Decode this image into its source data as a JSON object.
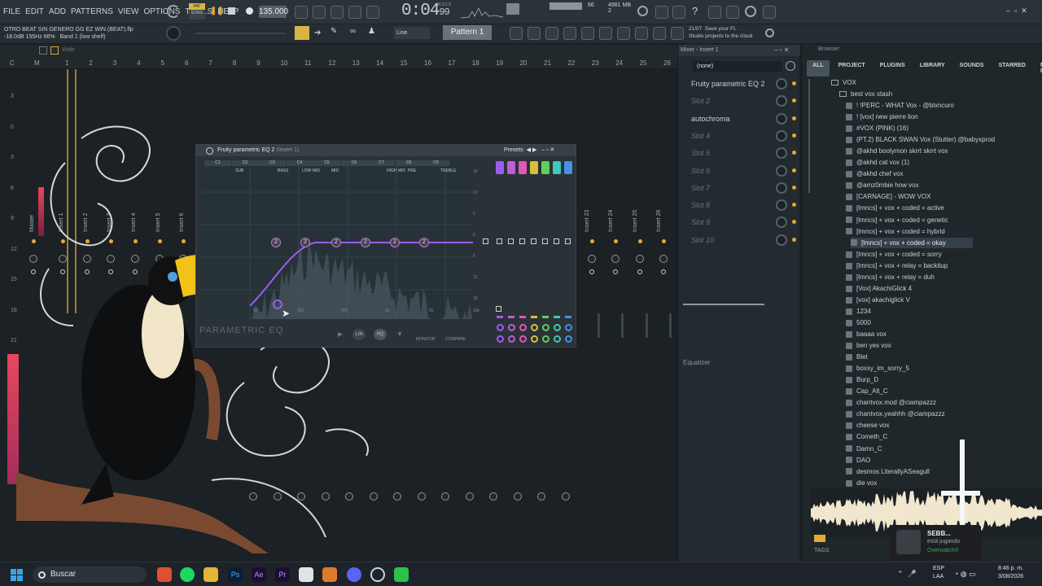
{
  "menu": [
    "FILE",
    "EDIT",
    "ADD",
    "PATTERNS",
    "VIEW",
    "OPTIONS",
    "TOOLS",
    "HELP"
  ],
  "transport": {
    "pat_label": "PAT",
    "song_label": "SONG",
    "tempo": "135.000",
    "time_main": "0:04",
    "time_sub": "99",
    "time_unit": "M:S:CS",
    "cpu_value": "66",
    "memory": "4981 MB",
    "memory_sub": "2"
  },
  "hint": {
    "line1": "OTRO BEAT SIN GENERO GG EZ WIN (BEAT).flp",
    "line2": "-18.0dB 155Hz 66%",
    "line3": "Band 1 (low shelf)"
  },
  "toolbar": {
    "snap": "Line",
    "pattern": "Pattern 1"
  },
  "news": {
    "date": "21/07",
    "text1": "Save your FL",
    "text2": "Studio projects to the cloud"
  },
  "playlist": {
    "wide_label": "Wide",
    "ruler_letters": [
      "C",
      "M"
    ],
    "ruler_nums": [
      "1",
      "2",
      "3",
      "4",
      "5",
      "6",
      "7",
      "8",
      "9",
      "10",
      "11",
      "12",
      "13",
      "14",
      "15",
      "16",
      "17",
      "18",
      "19",
      "20",
      "21",
      "22",
      "23",
      "24",
      "25",
      "26"
    ],
    "db_marks": [
      "3",
      "0",
      "3",
      "6",
      "9",
      "12",
      "15",
      "18",
      "21"
    ]
  },
  "mixer_tracks": {
    "left": [
      "Master",
      "Insert 1",
      "Insert 2",
      "Insert 3",
      "Insert 4",
      "Insert 5",
      "Insert 6"
    ],
    "right": [
      "Insert 23",
      "Insert 24",
      "Insert 25",
      "Insert 26"
    ]
  },
  "eq": {
    "title": "Fruity parametric EQ 2",
    "insert": "(Insert 1)",
    "presets": "Presets",
    "bands": [
      "C1",
      "C2",
      "C3",
      "C4",
      "C5",
      "C6",
      "C7",
      "C8",
      "C9"
    ],
    "band_names": [
      "SUB",
      "BASS",
      "LOW MID",
      "MID",
      "HIGH MID",
      "PRE",
      "TREBLE"
    ],
    "db_scale": [
      "18",
      "12",
      "6",
      "0",
      "6",
      "12",
      "18"
    ],
    "freq_scale": [
      "50",
      "100",
      "500",
      "1k",
      "5k",
      "10k"
    ],
    "monitor": "MONITOR",
    "compare": "COMPARE",
    "param_label": "PARAMETRIC EQ",
    "mode_labels": [
      "LIN",
      "HQ"
    ],
    "band_colors": [
      "#9c5cf0",
      "#c05cd8",
      "#e057b8",
      "#d6c23a",
      "#5fcf5a",
      "#3ec8b8",
      "#4a8ee6"
    ]
  },
  "mixer_panel": {
    "title": "Mixer - Insert 1",
    "input": "(none)",
    "slots": [
      "Fruity parametric EQ 2",
      "Slot 2",
      "autochroma",
      "Slot 4",
      "Slot 5",
      "Slot 6",
      "Slot 7",
      "Slot 8",
      "Slot 9",
      "Slot 10"
    ],
    "equalizer": "Equalizer"
  },
  "browser": {
    "title": "Browser",
    "tabs": [
      "ALL",
      "PROJECT",
      "PLUGINS",
      "LIBRARY",
      "SOUNDS",
      "STARRED",
      "MY PROJ..."
    ],
    "root": "VOX",
    "subfolder": "best vox stash",
    "files": [
      "! !PERC - WHAT Vox - @blxncuro",
      "! [vox] new pierre lion",
      "#VOX (PINK) (16)",
      "(PT.2) BLACK SWAN Vox (Stutter) @babyxprod",
      "@akhd boolymon skrrt skrrt vox",
      "@akhd cat vox (1)",
      "@akhd chef vox",
      "@amz0mbie how vox",
      "[CARNAGE] - WOW VOX",
      "[lmncs] + vox + coded = active",
      "[lmncs] + vox + coded = genetic",
      "[lmncs] + vox + coded = hybrid",
      "[lmncs] + vox + coded = okay",
      "[lmncs] + vox + coded = sorry",
      "[lmncs] + vox + relay = backitup",
      "[lmncs] + vox + relay = duh",
      "[Vox] AkachiGlick 4",
      "[vox] akachiglick V",
      "1234",
      "5000",
      "baaaa vox",
      "ben yes vox",
      "Blet",
      "boxxy_im_sorry_5",
      "Burp_D",
      "Cap_Alt_C",
      "chantvox.mod @ciampazzz",
      "chantvox.yeahhh @ciampazzz",
      "cheese vox",
      "Cometh_C",
      "Damn_C",
      "DAO",
      "desmos LiterallyASeagull",
      "die vox"
    ],
    "tags": "TAGS",
    "selected_index": 12
  },
  "notification": {
    "name": "SEBB...",
    "status": "está jugando",
    "game": "Overwatch®"
  },
  "taskbar": {
    "search": "Buscar",
    "lang1": "ESP",
    "lang2": "LAA",
    "time": "8:46 p. m.",
    "date": "3/08/2026"
  },
  "colors": {
    "accent": "#e3a935",
    "eq_curve": "#9c5cf0",
    "meter": "#e8465c"
  }
}
